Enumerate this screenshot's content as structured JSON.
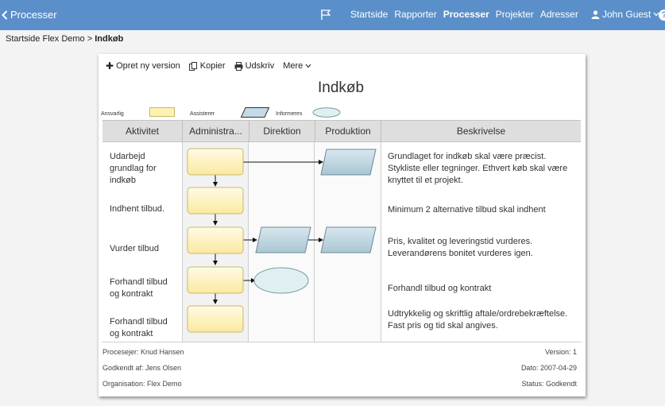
{
  "topbar": {
    "back_label": "Processer",
    "nav": [
      "Startside",
      "Rapporter",
      "Processer",
      "Projekter",
      "Adresser"
    ],
    "active_nav": "Processer",
    "user": "John Guest",
    "help": "?",
    "accent_color": "#5b8fc9"
  },
  "breadcrumb": {
    "items": [
      "Startside",
      "Flex Demo"
    ],
    "separator": ">",
    "current": "Indkøb"
  },
  "toolbar": {
    "new_version": "Opret ny version",
    "copy": "Kopier",
    "print": "Udskriv",
    "more": "Mere"
  },
  "process": {
    "title": "Indkøb",
    "legend": {
      "responsible": "Ansvarlig",
      "assists": "Assisterer",
      "informed": "Informeres"
    },
    "columns": [
      "Aktivitet",
      "Administra...",
      "Direktion",
      "Produktion",
      "Beskrivelse"
    ],
    "rows": [
      {
        "activity": "Udarbejd grundlag for indkøb",
        "description": "Grundlaget for indkøb skal være præcist. Stykliste eller tegninger. Ethvert køb skal være knyttet til et projekt."
      },
      {
        "activity": "Indhent tilbud.",
        "description": "Minimum 2 alternative tilbud skal indhent"
      },
      {
        "activity": "Vurder tilbud",
        "description": "Pris, kvalitet og leveringstid vurderes. Leverandørens bonitet vurderes igen."
      },
      {
        "activity": "Forhandl tilbud og kontrakt",
        "description": "Forhandl tilbud og kontrakt"
      },
      {
        "activity": "Forhandl tilbud og kontrakt",
        "description": "Udtrykkelig og skriftlig aftale/ordrebekræftelse. Fast pris og tid skal angives."
      }
    ],
    "colors": {
      "responsible_fill": "#fdf2b4",
      "assists_fill": "#c4dbe5",
      "informed_fill": "#e0f0f2"
    }
  },
  "footer": {
    "owner": "Procesejer: Knud Hansen",
    "approved_by": "Godkendt af: Jens Olsen",
    "organisation": "Organisation: Flex Demo",
    "version": "Version: 1",
    "date": "Dato: 2007-04-29",
    "status": "Status: Godkendt"
  }
}
